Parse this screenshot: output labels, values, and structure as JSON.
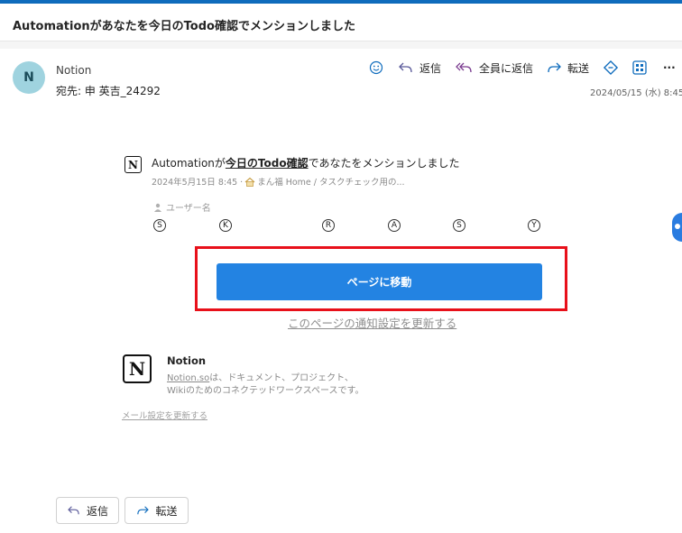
{
  "email": {
    "subject": "Automationがあなたを今日のTodo確認でメンションしました",
    "sender": {
      "initial": "N",
      "name": "Notion"
    },
    "recipient": "宛先:  申 英吉_24292",
    "timestamp": "2024/05/15 (水) 8:45"
  },
  "toolbar": {
    "reply": "返信",
    "reply_all": "全員に返信",
    "forward": "転送",
    "more": "···"
  },
  "body": {
    "headline_pre": "Automationが",
    "headline_link": "今日のTodo確認",
    "headline_post": "であなたをメンションしました",
    "meta_date": "2024年5月15日 8:45 · ",
    "meta_path": "まん福 Home / タスクチェック用の...",
    "user_label": "ユーザー名",
    "letters": [
      "S",
      "K",
      "R",
      "A",
      "S",
      "Y"
    ],
    "goto_button": "ページに移動",
    "notification_link": "このページの通知設定を更新する"
  },
  "footer": {
    "logo": "N",
    "brand": "Notion",
    "line1_link": "Notion.so",
    "line1_rest": "は、ドキュメント、プロジェクト、",
    "line2": "Wikiのためのコネクテッドワークスペースです。",
    "mail_settings": "メール設定を更新する"
  },
  "bottom_actions": {
    "reply": "返信",
    "forward": "転送"
  },
  "colors": {
    "accent": "#0f6cbd",
    "notion_button": "#2383e2",
    "highlight": "#e8101a",
    "avatar_bg": "#9fd3df"
  }
}
